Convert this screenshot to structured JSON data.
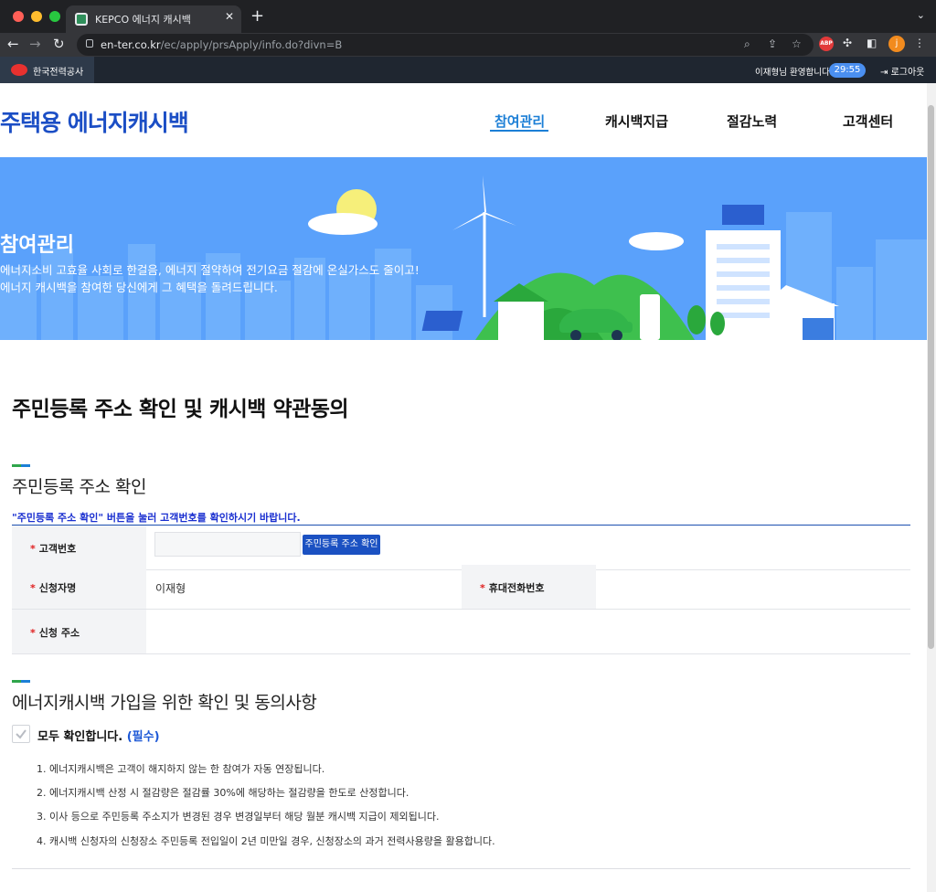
{
  "browser": {
    "tab_title": "KEPCO 에너지 캐시백",
    "url_host": "en-ter.co.kr",
    "url_path": "/ec/apply/prsApply/info.do?divn=B",
    "profile_initial": "j",
    "adblock_label": "ABP"
  },
  "topbar": {
    "org_name": "한국전력공사",
    "welcome": "이재형님 환영합니다.",
    "session_timer": "29:55",
    "logout_label": "로그아웃"
  },
  "header": {
    "site_title": "주택용 에너지캐시백",
    "nav": [
      "참여관리",
      "캐시백지급",
      "절감노력",
      "고객센터"
    ],
    "active_nav": "참여관리"
  },
  "banner": {
    "title": "참여관리",
    "line1": "에너지소비 고효율 사회로 한걸음, 에너지 절약하여 전기요금 절감에 온실가스도 줄이고!",
    "line2": "에너지 캐시백을 참여한 당신에게 그 혜택을 돌려드립니다."
  },
  "page": {
    "title": "주민등록 주소 확인 및 캐시백 약관동의"
  },
  "section_address": {
    "title": "주민등록 주소 확인",
    "notice": "\"주민등록 주소 확인\" 버튼을 눌러 고객번호를 확인하시기 바랍니다.",
    "required_mark": "*",
    "labels": {
      "customer_no": "고객번호",
      "applicant_name": "신청자명",
      "mobile": "휴대전화번호",
      "address": "신청 주소"
    },
    "customer_no_value": "",
    "verify_button": "주민등록 주소 확인",
    "applicant_name_value": "이재형",
    "mobile_value": "",
    "address_value": ""
  },
  "section_agree": {
    "title": "에너지캐시백 가입을 위한 확인 및 동의사항",
    "check_all_label": "모두 확인합니다.",
    "required_label": "(필수)",
    "items": [
      "1. 에너지캐시백은 고객이 해지하지 않는 한 참여가 자동 연장됩니다.",
      "2. 에너지캐시백 산정 시 절감량은 절감률 30%에 해당하는 절감량을 한도로 산정합니다.",
      "3. 이사 등으로 주민등록 주소지가 변경된 경우 변경일부터 해당 월분 캐시백 지급이 제외됩니다.",
      "4. 캐시백 신청자의 신청장소 주민등록 전입일이 2년 미만일 경우, 신청장소의 과거 전력사용량을 활용합니다."
    ]
  },
  "colors": {
    "brand_blue": "#1b4ec5",
    "active_nav": "#1c7fd6",
    "banner_bg": "#5aa1fb",
    "button_blue": "#1b51c2",
    "required_red": "#e02020",
    "notice_blue": "#1a2fd0"
  }
}
